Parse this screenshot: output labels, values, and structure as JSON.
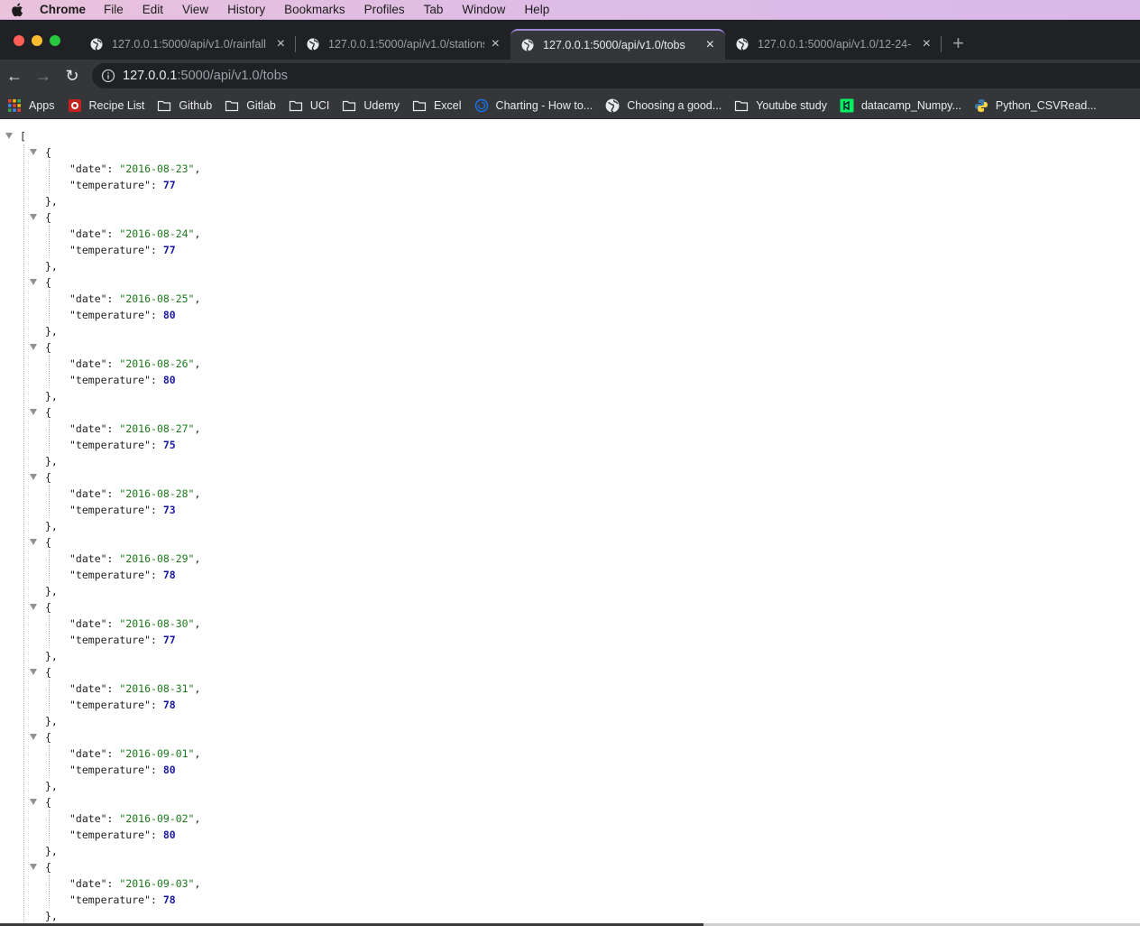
{
  "menubar": {
    "app_name": "Chrome",
    "items": [
      "File",
      "Edit",
      "View",
      "History",
      "Bookmarks",
      "Profiles",
      "Tab",
      "Window",
      "Help"
    ]
  },
  "tabs": [
    {
      "title": "127.0.0.1:5000/api/v1.0/rainfall",
      "active": false
    },
    {
      "title": "127.0.0.1:5000/api/v1.0/stations",
      "active": false
    },
    {
      "title": "127.0.0.1:5000/api/v1.0/tobs",
      "active": true
    },
    {
      "title": "127.0.0.1:5000/api/v1.0/12-24-",
      "active": false
    }
  ],
  "omnibox": {
    "host": "127.0.0.1",
    "path": ":5000/api/v1.0/tobs"
  },
  "bookmarks": [
    {
      "label": "Apps",
      "icon": "apps-grid-icon"
    },
    {
      "label": "Recipe List",
      "icon": "recipe-icon"
    },
    {
      "label": "Github",
      "icon": "folder-icon"
    },
    {
      "label": "Gitlab",
      "icon": "folder-icon"
    },
    {
      "label": "UCI",
      "icon": "folder-icon"
    },
    {
      "label": "Udemy",
      "icon": "folder-icon"
    },
    {
      "label": "Excel",
      "icon": "folder-icon"
    },
    {
      "label": "Charting - How to...",
      "icon": "circle-logo-icon"
    },
    {
      "label": "Choosing a good...",
      "icon": "globe-icon"
    },
    {
      "label": "Youtube study",
      "icon": "folder-icon"
    },
    {
      "label": "datacamp_Numpy...",
      "icon": "datacamp-icon"
    },
    {
      "label": "Python_CSVRead...",
      "icon": "python-icon"
    }
  ],
  "json_view": {
    "open_bracket": "[",
    "records": [
      {
        "date": "2016-08-23",
        "temperature": 77
      },
      {
        "date": "2016-08-24",
        "temperature": 77
      },
      {
        "date": "2016-08-25",
        "temperature": 80
      },
      {
        "date": "2016-08-26",
        "temperature": 80
      },
      {
        "date": "2016-08-27",
        "temperature": 75
      },
      {
        "date": "2016-08-28",
        "temperature": 73
      },
      {
        "date": "2016-08-29",
        "temperature": 78
      },
      {
        "date": "2016-08-30",
        "temperature": 77
      },
      {
        "date": "2016-08-31",
        "temperature": 78
      },
      {
        "date": "2016-09-01",
        "temperature": 80
      },
      {
        "date": "2016-09-02",
        "temperature": 80
      },
      {
        "date": "2016-09-03",
        "temperature": 78
      }
    ]
  },
  "colors": {
    "string_value": "#1a7a1a",
    "number_value": "#1a1aa6",
    "active_tab_accent": "#9d86d8"
  }
}
